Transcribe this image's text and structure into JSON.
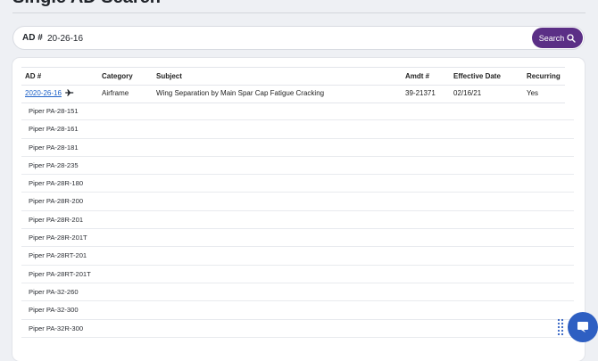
{
  "page": {
    "title": "Single AD Search"
  },
  "search": {
    "label": "AD #",
    "value": "20-26-16",
    "button_label": "Search"
  },
  "table": {
    "headers": [
      "AD #",
      "Category",
      "Subject",
      "Amdt #",
      "Effective Date",
      "Recurring"
    ],
    "row": {
      "ad_number": "2020-26-16",
      "category": "Airframe",
      "subject": "Wing Separation by Main Spar Cap Fatigue Cracking",
      "amdt": "39-21371",
      "effective_date": "02/16/21",
      "recurring": "Yes"
    }
  },
  "models": [
    "Piper PA-28-151",
    "Piper PA-28-161",
    "Piper PA-28-181",
    "Piper PA-28-235",
    "Piper PA-28R-180",
    "Piper PA-28R-200",
    "Piper PA-28R-201",
    "Piper PA-28R-201T",
    "Piper PA-28RT-201",
    "Piper PA-28RT-201T",
    "Piper PA-32-260",
    "Piper PA-32-300",
    "Piper PA-32R-300"
  ],
  "colors": {
    "accent": "#5b2f86",
    "link": "#1e62c8",
    "chat": "#2e5fc2"
  },
  "icons": {
    "search": "search-icon",
    "aircraft": "airplane-icon",
    "chat": "chat-icon",
    "drag": "grip-icon"
  }
}
